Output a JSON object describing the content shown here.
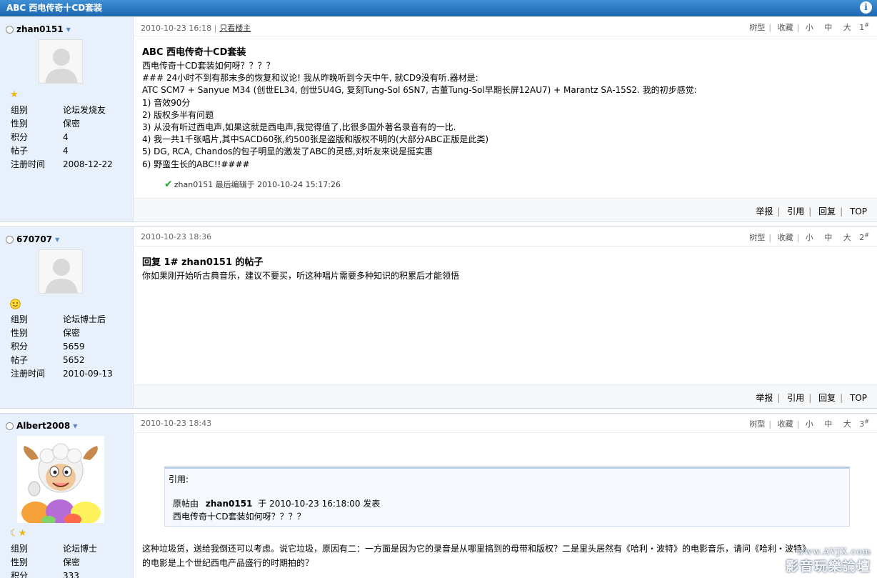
{
  "window": {
    "title": "ABC 西电传奇十CD套装"
  },
  "toolbar_labels": {
    "tree": "树型",
    "fav": "收藏",
    "small": "小",
    "mid": "中",
    "big": "大"
  },
  "actions": {
    "report": "举报",
    "quote": "引用",
    "reply": "回复",
    "top": "TOP"
  },
  "stat_labels": {
    "group": "组别",
    "gender": "性别",
    "points": "积分",
    "posts": "帖子",
    "reg": "注册时间"
  },
  "posts": [
    {
      "user": "zhan0151",
      "group": "论坛发烧友",
      "gender": "保密",
      "points": "4",
      "posts": "4",
      "reg": "2008-12-22",
      "date": "2010-10-23 16:18",
      "only_author": "只看楼主",
      "floor": "1",
      "title": "ABC 西电传奇十CD套装",
      "body": [
        "西电传奇十CD套装如何呀？？？？",
        "### 24小时不到有那末多的恢复和议论! 我从昨晚听到今天中午, 就CD9没有听.器材是:",
        "ATC SCM7 + Sanyue M34 (创世EL34, 创世5U4G, 复刻Tung-Sol 6SN7, 古董Tung-Sol早期长屏12AU7) + Marantz SA-15S2. 我的初步感觉:",
        "1) 音效90分",
        "2) 版权多半有问题",
        "3) 从没有听过西电声,如果这就是西电声,我觉得值了,比很多国外著名录音有的一比.",
        "4) 我一共1千张唱片,其中SACD60张,约500张是盗版和版权不明的(大部分ABC正版是此类)",
        "5) DG, RCA, Chandos的包子明显的激发了ABC的灵感,对听友来说是挺实惠",
        "6) 野蛮生长的ABC!!####"
      ],
      "edited": "zhan0151 最后编辑于  2010-10-24 15:17:26"
    },
    {
      "user": "670707",
      "group": "论坛博士后",
      "gender": "保密",
      "points": "5659",
      "posts": "5652",
      "reg": "2010-09-13",
      "date": "2010-10-23 18:36",
      "floor": "2",
      "title": "回复  1# zhan0151 的帖子",
      "body": [
        "你如果刚开始听古典音乐，建议不要买，听这种唱片需要多种知识的积累后才能领悟"
      ]
    },
    {
      "user": "Albert2008",
      "group": "论坛博士",
      "gender": "保密",
      "points": "333",
      "date": "2010-10-23 18:43",
      "floor": "3",
      "quote_header": "引用:",
      "quote_src_prefix": "原帖由",
      "quote_src_user": "zhan0151",
      "quote_src_suffix": "于  2010-10-23 16:18:00 发表",
      "quote_text": "西电传奇十CD套装如何呀？？？？",
      "body": [
        "这种垃圾货，送给我倒还可以考虑。说它垃圾，原因有二：一方面是因为它的录音是从哪里搞到的母带和版权？二是里头居然有《哈利・波特》的电影音乐，请问《哈利・波特》",
        "的电影是上个世纪西电产品盛行的时期拍的？"
      ]
    }
  ],
  "watermark": {
    "line1": "www.AVJX.com",
    "line2": "影音玩樂論壇"
  }
}
